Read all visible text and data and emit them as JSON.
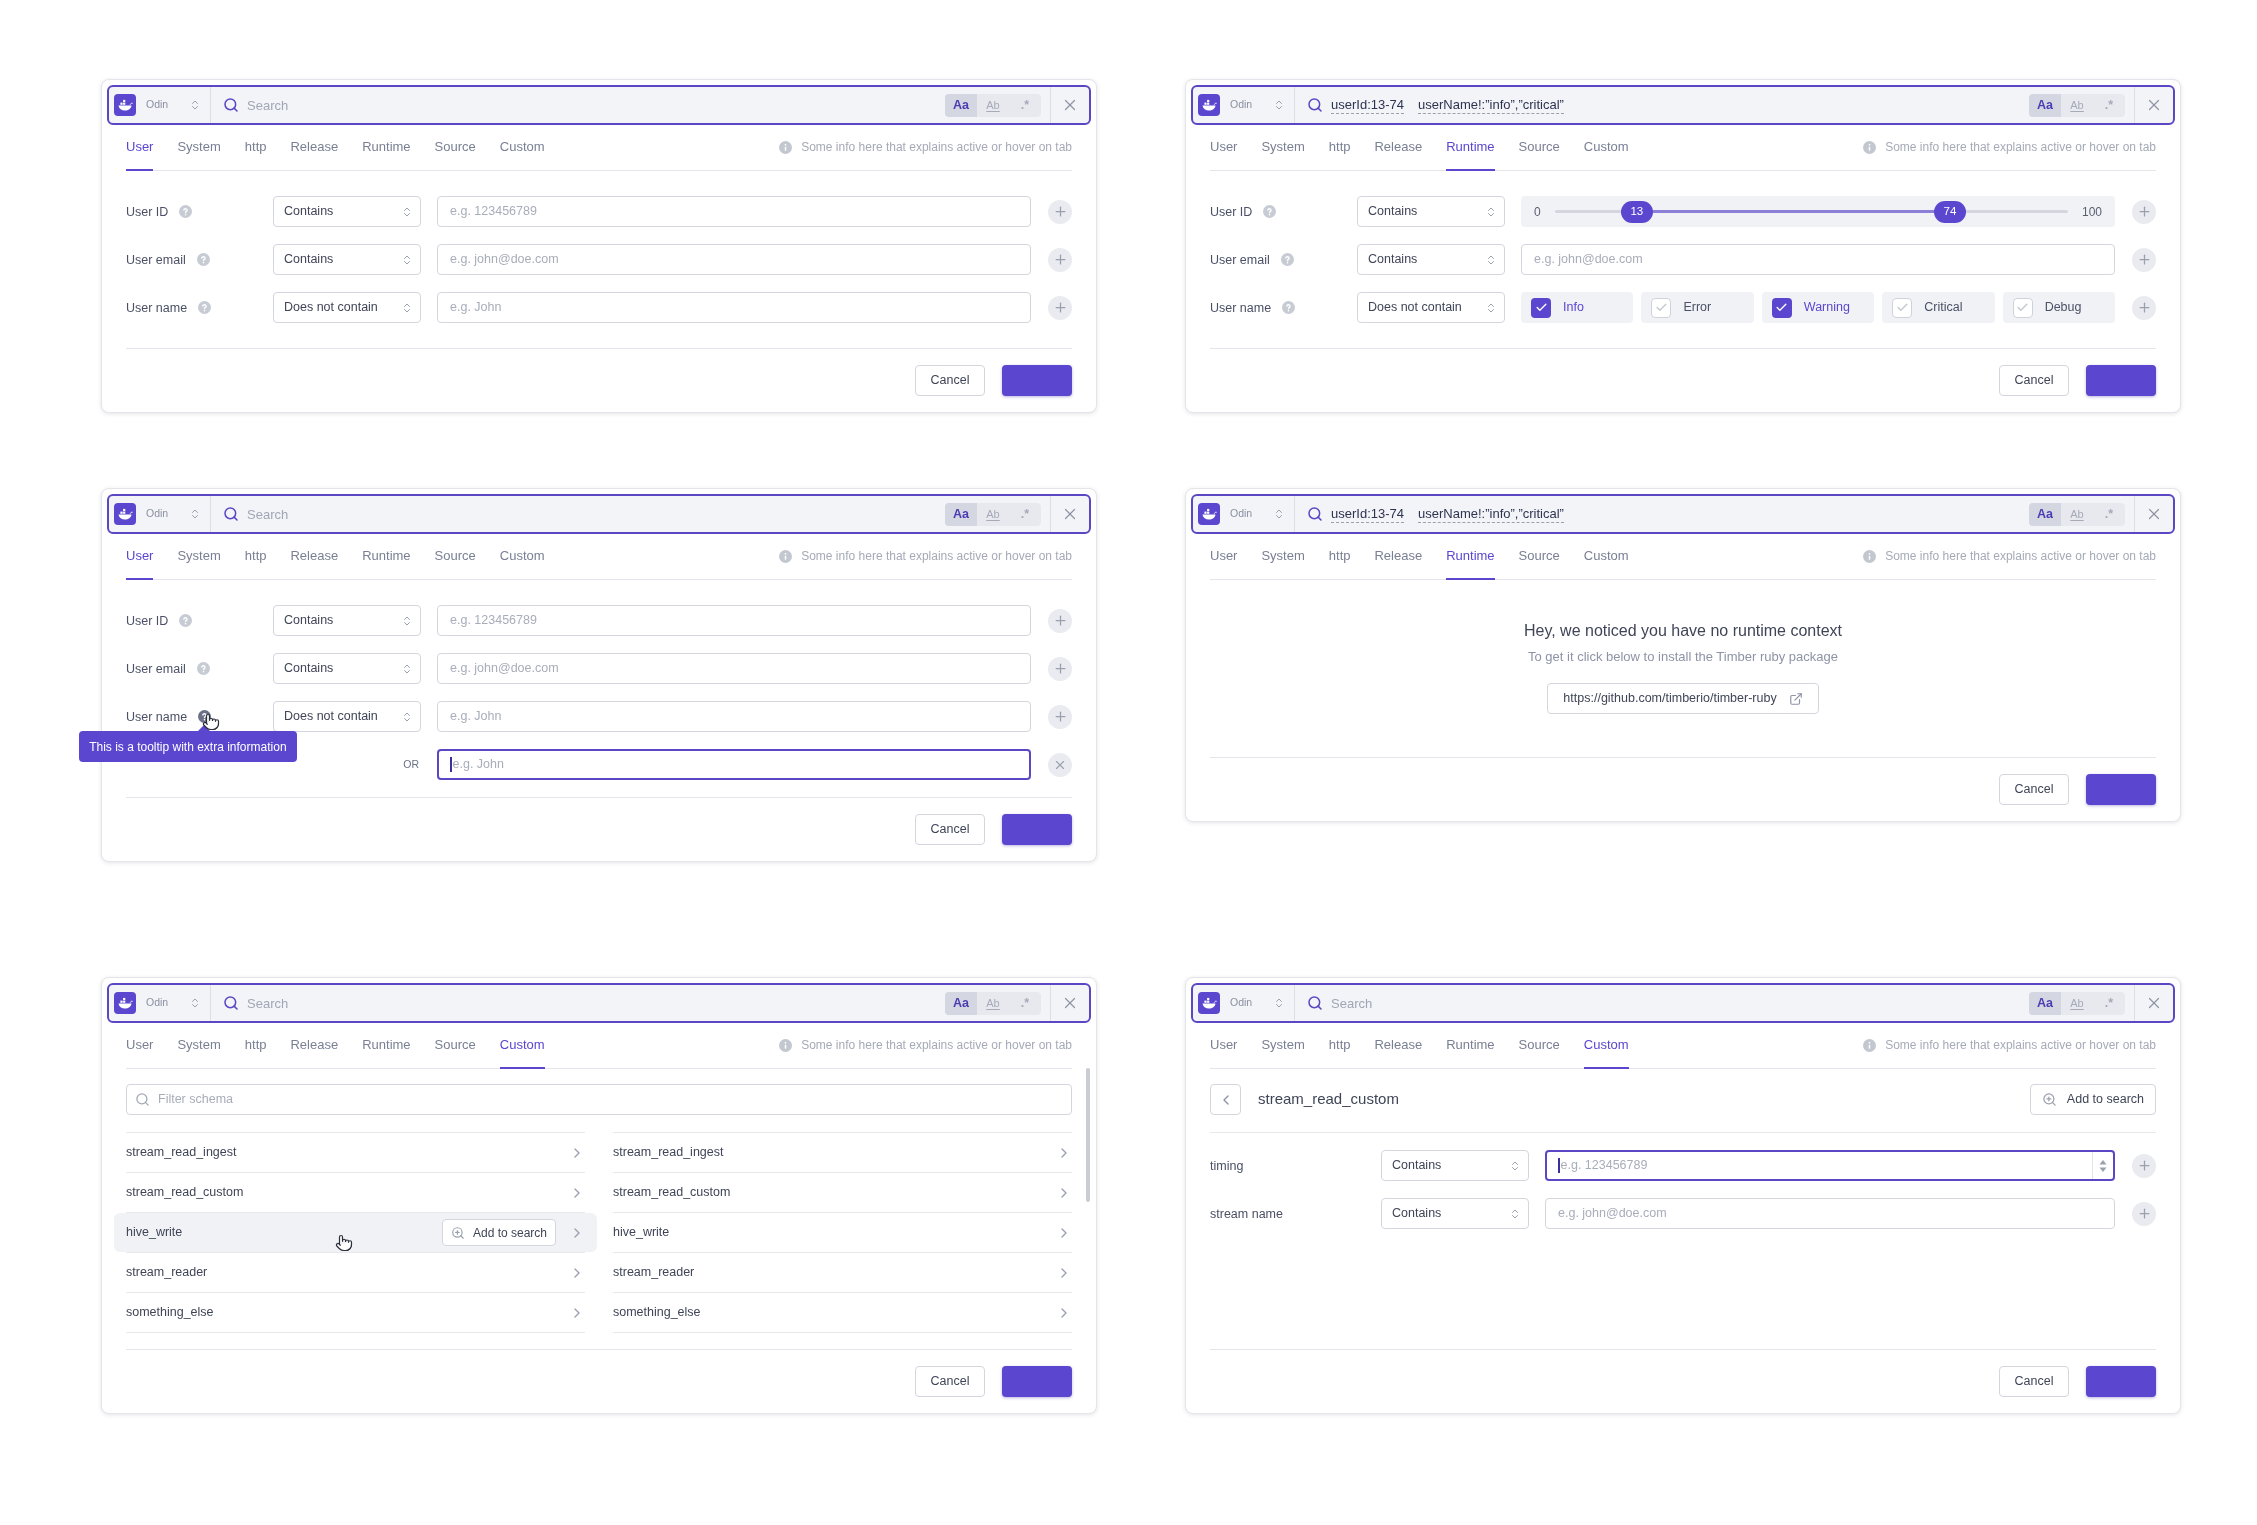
{
  "panels": [
    {
      "kind": "fields",
      "search": {
        "product": "Odin",
        "placeholder": "Search",
        "options": [
          {
            "kind": "case",
            "label": "Aa",
            "selected": true
          },
          {
            "kind": "word",
            "label": "Ab",
            "selected": false
          },
          {
            "kind": "regex",
            "label": ".*",
            "selected": false
          }
        ]
      },
      "tabs": [
        {
          "label": "User",
          "selected": true
        },
        {
          "label": "System",
          "selected": false
        },
        {
          "label": "http",
          "selected": false
        },
        {
          "label": "Release",
          "selected": false
        },
        {
          "label": "Runtime",
          "selected": false
        },
        {
          "label": "Source",
          "selected": false
        },
        {
          "label": "Custom",
          "selected": false
        }
      ],
      "tab_info": "Some info here that explains active or hover on tab",
      "rows": [
        {
          "kind": "text",
          "label": "User ID",
          "help": true,
          "operator": "Contains",
          "placeholder": "e.g. 123456789",
          "focused": false
        },
        {
          "kind": "text",
          "label": "User email",
          "help": true,
          "operator": "Contains",
          "placeholder": "e.g. john@doe.com",
          "focused": false
        },
        {
          "kind": "text",
          "label": "User name",
          "help": true,
          "operator": "Does not contain",
          "placeholder": "e.g. John",
          "focused": false
        }
      ],
      "cancel": "Cancel"
    },
    {
      "kind": "fields",
      "search": {
        "product": "Odin",
        "tokens": [
          "userId:13-74",
          "userName!:”info”,”critical”"
        ],
        "options": [
          {
            "kind": "case",
            "label": "Aa",
            "selected": true
          },
          {
            "kind": "word",
            "label": "Ab",
            "selected": false
          },
          {
            "kind": "regex",
            "label": ".*",
            "selected": false
          }
        ]
      },
      "tabs": [
        {
          "label": "User",
          "selected": false
        },
        {
          "label": "System",
          "selected": false
        },
        {
          "label": "http",
          "selected": false
        },
        {
          "label": "Release",
          "selected": false
        },
        {
          "label": "Runtime",
          "selected": true
        },
        {
          "label": "Source",
          "selected": false
        },
        {
          "label": "Custom",
          "selected": false
        }
      ],
      "tab_info": "Some info here that explains active or hover on tab",
      "rows": [
        {
          "kind": "range",
          "label": "User ID",
          "help": true,
          "operator": "Contains",
          "min": "0",
          "max": "100",
          "low": {
            "reading": "13",
            "level": 0.16
          },
          "high": {
            "reading": "74",
            "level": 0.77
          }
        },
        {
          "kind": "text",
          "label": "User email",
          "help": true,
          "operator": "Contains",
          "placeholder": "e.g. john@doe.com",
          "focused": false
        },
        {
          "kind": "levels",
          "label": "User name",
          "help": true,
          "operator": "Does not contain",
          "options": [
            {
              "label": "Info",
              "checked": true
            },
            {
              "label": "Error",
              "checked": false
            },
            {
              "label": "Warning",
              "checked": true
            },
            {
              "label": "Critical",
              "checked": false
            },
            {
              "label": "Debug",
              "checked": false
            }
          ]
        }
      ],
      "cancel": "Cancel"
    },
    {
      "kind": "fields",
      "search": {
        "product": "Odin",
        "placeholder": "Search",
        "options": [
          {
            "kind": "case",
            "label": "Aa",
            "selected": true
          },
          {
            "kind": "word",
            "label": "Ab",
            "selected": false
          },
          {
            "kind": "regex",
            "label": ".*",
            "selected": false
          }
        ]
      },
      "tabs": [
        {
          "label": "User",
          "selected": true
        },
        {
          "label": "System",
          "selected": false
        },
        {
          "label": "http",
          "selected": false
        },
        {
          "label": "Release",
          "selected": false
        },
        {
          "label": "Runtime",
          "selected": false
        },
        {
          "label": "Source",
          "selected": false
        },
        {
          "label": "Custom",
          "selected": false
        }
      ],
      "tab_info": "Some info here that explains active or hover on tab",
      "rows": [
        {
          "kind": "text",
          "label": "User ID",
          "help": true,
          "operator": "Contains",
          "placeholder": "e.g. 123456789",
          "focused": false
        },
        {
          "kind": "text",
          "label": "User email",
          "help": true,
          "operator": "Contains",
          "placeholder": "e.g. john@doe.com",
          "focused": false
        },
        {
          "kind": "text",
          "label": "User name",
          "help": true,
          "tooltip": "This is a tooltip with extra information",
          "operator": "Does not contain",
          "placeholder": "e.g. John",
          "focused": false
        },
        {
          "kind": "or",
          "connector": "OR",
          "placeholder": "e.g. John",
          "focused": true
        }
      ],
      "cancel": "Cancel"
    },
    {
      "kind": "empty",
      "search": {
        "product": "Odin",
        "tokens": [
          "userId:13-74",
          "userName!:”info”,”critical”"
        ],
        "options": [
          {
            "kind": "case",
            "label": "Aa",
            "selected": true
          },
          {
            "kind": "word",
            "label": "Ab",
            "selected": false
          },
          {
            "kind": "regex",
            "label": ".*",
            "selected": false
          }
        ]
      },
      "tabs": [
        {
          "label": "User",
          "selected": false
        },
        {
          "label": "System",
          "selected": false
        },
        {
          "label": "http",
          "selected": false
        },
        {
          "label": "Release",
          "selected": false
        },
        {
          "label": "Runtime",
          "selected": true
        },
        {
          "label": "Source",
          "selected": false
        },
        {
          "label": "Custom",
          "selected": false
        }
      ],
      "tab_info": "Some info here that explains active or hover on tab",
      "empty": {
        "title": "Hey, we noticed you have no runtime context",
        "subtitle": "To get it click below to install the Timber ruby package",
        "link": "https://github.com/timberio/timber-ruby"
      },
      "cancel": "Cancel"
    },
    {
      "kind": "schema_list",
      "search": {
        "product": "Odin",
        "placeholder": "Search",
        "options": [
          {
            "kind": "case",
            "label": "Aa",
            "selected": true
          },
          {
            "kind": "word",
            "label": "Ab",
            "selected": false
          },
          {
            "kind": "regex",
            "label": ".*",
            "selected": false
          }
        ]
      },
      "tabs": [
        {
          "label": "User",
          "selected": false
        },
        {
          "label": "System",
          "selected": false
        },
        {
          "label": "http",
          "selected": false
        },
        {
          "label": "Release",
          "selected": false
        },
        {
          "label": "Runtime",
          "selected": false
        },
        {
          "label": "Source",
          "selected": false
        },
        {
          "label": "Custom",
          "selected": true
        }
      ],
      "tab_info": "Some info here that explains active or hover on tab",
      "filter_placeholder": "Filter schema",
      "columns": [
        {
          "items": [
            {
              "name": "stream_read_ingest",
              "hovered": false
            },
            {
              "name": "stream_read_custom",
              "hovered": false
            },
            {
              "name": "hive_write",
              "hovered": true,
              "action": "Add to search"
            },
            {
              "name": "stream_reader",
              "hovered": false
            },
            {
              "name": "something_else",
              "hovered": false
            }
          ]
        },
        {
          "items": [
            {
              "name": "stream_read_ingest",
              "hovered": false
            },
            {
              "name": "stream_read_custom",
              "hovered": false
            },
            {
              "name": "hive_write",
              "hovered": false
            },
            {
              "name": "stream_reader",
              "hovered": false
            },
            {
              "name": "something_else",
              "hovered": false
            }
          ]
        }
      ],
      "cancel": "Cancel"
    },
    {
      "kind": "schema_detail",
      "search": {
        "product": "Odin",
        "placeholder": "Search",
        "options": [
          {
            "kind": "case",
            "label": "Aa",
            "selected": true
          },
          {
            "kind": "word",
            "label": "Ab",
            "selected": false
          },
          {
            "kind": "regex",
            "label": ".*",
            "selected": false
          }
        ]
      },
      "tabs": [
        {
          "label": "User",
          "selected": false
        },
        {
          "label": "System",
          "selected": false
        },
        {
          "label": "http",
          "selected": false
        },
        {
          "label": "Release",
          "selected": false
        },
        {
          "label": "Runtime",
          "selected": false
        },
        {
          "label": "Source",
          "selected": false
        },
        {
          "label": "Custom",
          "selected": true
        }
      ],
      "tab_info": "Some info here that explains active or hover on tab",
      "title": "stream_read_custom",
      "action": "Add to search",
      "rows": [
        {
          "kind": "number",
          "label": "timing",
          "help": false,
          "operator": "Contains",
          "placeholder": "e.g. 123456789",
          "focused": true
        },
        {
          "kind": "text",
          "label": "stream name",
          "help": false,
          "operator": "Contains",
          "placeholder": "e.g. john@doe.com",
          "focused": false
        }
      ],
      "cancel": "Cancel"
    }
  ]
}
